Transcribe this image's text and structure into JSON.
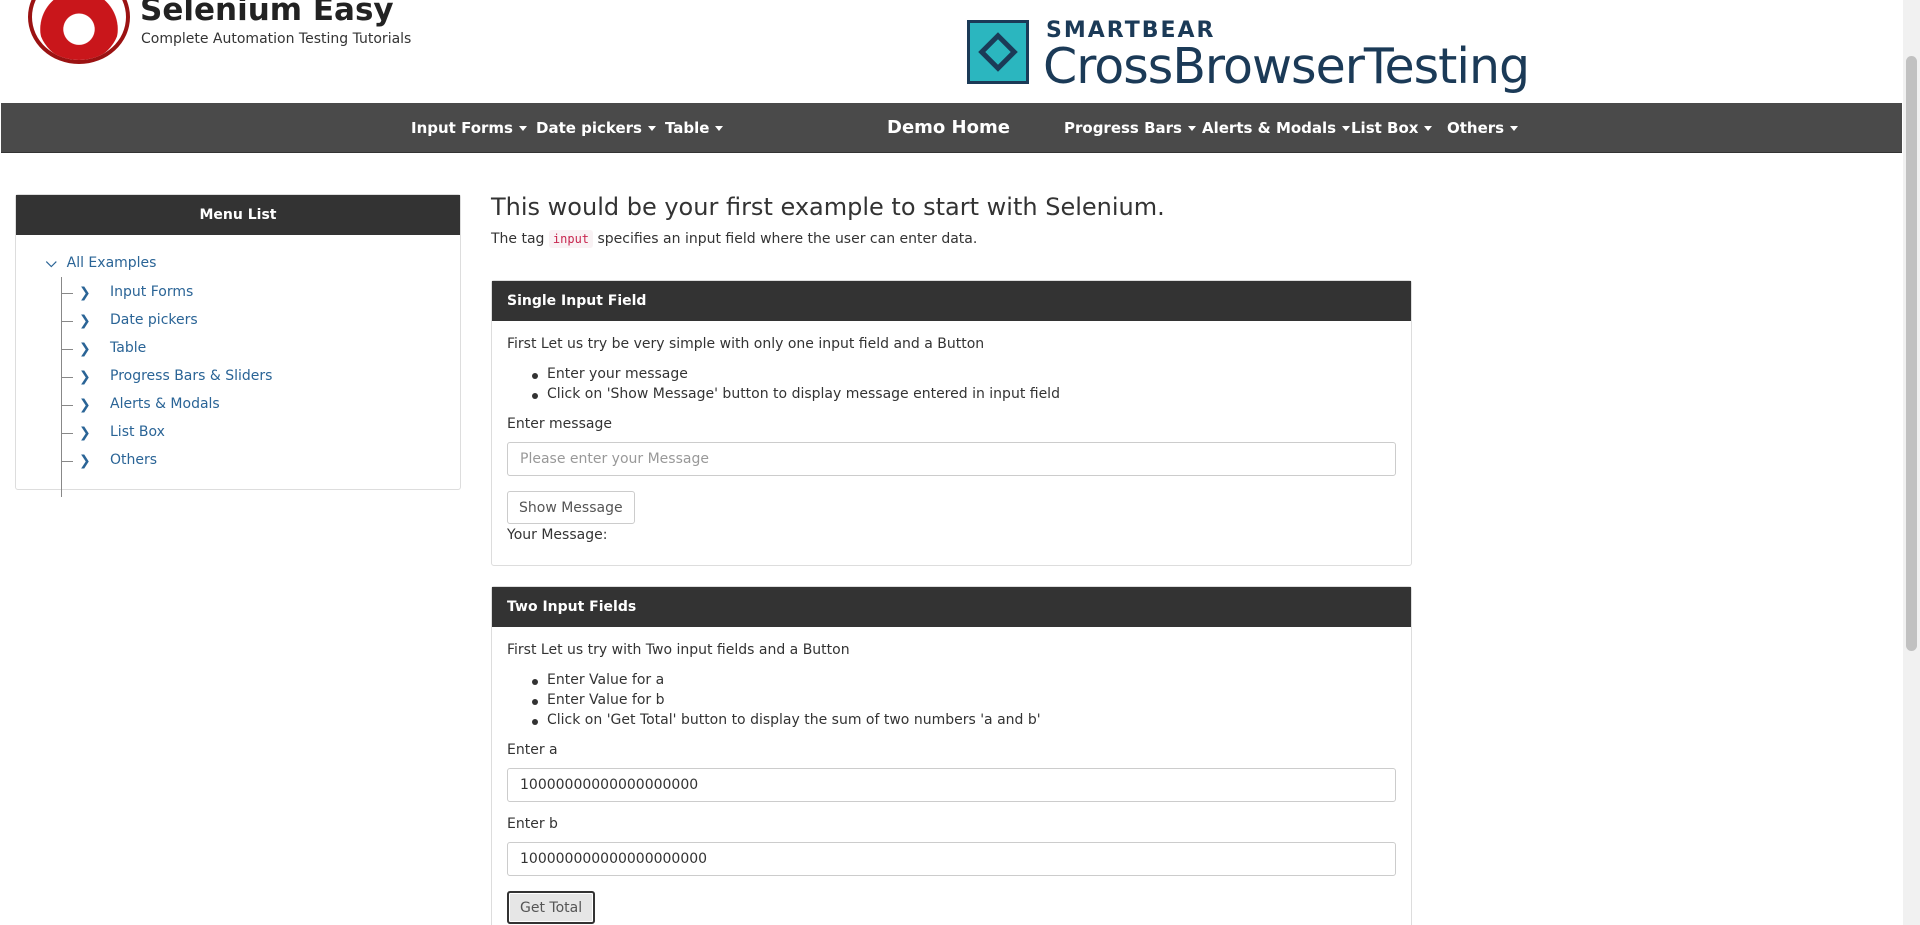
{
  "header": {
    "brand_title": "Selenium Easy",
    "brand_subtitle": "Complete Automation Testing Tutorials",
    "partner_company": "SMARTBEAR",
    "partner_product": "CrossBrowserTesting"
  },
  "navbar": {
    "items_left": [
      "Input Forms",
      "Date pickers",
      "Table"
    ],
    "home": "Demo Home",
    "items_right": [
      "Progress Bars",
      "Alerts & Modals",
      "List Box",
      "Others"
    ],
    "background": "#4a4a4a"
  },
  "sidebar": {
    "title": "Menu List",
    "root": "All Examples",
    "items": [
      "Input Forms",
      "Date pickers",
      "Table",
      "Progress Bars & Sliders",
      "Alerts & Modals",
      "List Box",
      "Others"
    ],
    "link_color": "#2a6496"
  },
  "main": {
    "title": "This would be your first example to start with Selenium.",
    "desc_prefix": "The tag",
    "desc_code": "input",
    "desc_suffix": "specifies an input field where the user can enter data."
  },
  "single_input": {
    "heading": "Single Input Field",
    "intro": "First Let us try be very simple with only one input field and a Button",
    "steps": [
      "Enter your message",
      "Click on 'Show Message' button to display message entered in input field"
    ],
    "label": "Enter message",
    "placeholder": "Please enter your Message",
    "value": "",
    "button": "Show Message",
    "result_label": "Your Message:"
  },
  "two_inputs": {
    "heading": "Two Input Fields",
    "intro": "First Let us try with Two input fields and a Button",
    "steps": [
      "Enter Value for a",
      "Enter Value for b",
      "Click on 'Get Total' button to display the sum of two numbers 'a and b'"
    ],
    "label_a": "Enter a",
    "value_a": "10000000000000000000",
    "label_b": "Enter b",
    "value_b": "100000000000000000000",
    "button": "Get Total"
  }
}
